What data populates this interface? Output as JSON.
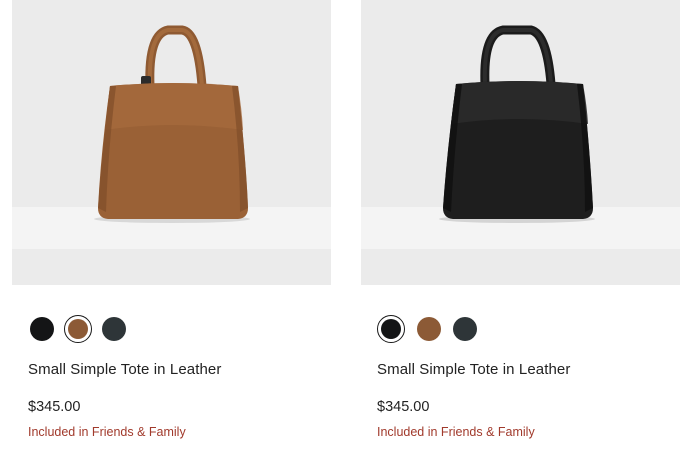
{
  "products": [
    {
      "name": "Small Simple Tote in Leather",
      "price": "$345.00",
      "promo": "Included in Friends & Family",
      "image_color": "brown",
      "selected_swatch": 1,
      "swatches": [
        {
          "color": "black",
          "hex": "#141516"
        },
        {
          "color": "brown",
          "hex": "#8c5a36"
        },
        {
          "color": "dark slate",
          "hex": "#2e3538"
        }
      ]
    },
    {
      "name": "Small Simple Tote in Leather",
      "price": "$345.00",
      "promo": "Included in Friends & Family",
      "image_color": "black",
      "selected_swatch": 0,
      "swatches": [
        {
          "color": "black",
          "hex": "#141516"
        },
        {
          "color": "brown",
          "hex": "#8c5a36"
        },
        {
          "color": "dark slate",
          "hex": "#2e3538"
        }
      ]
    }
  ],
  "colors": {
    "text": "#222222",
    "promo": "#a13a2c",
    "image_background": "#ebebeb"
  }
}
